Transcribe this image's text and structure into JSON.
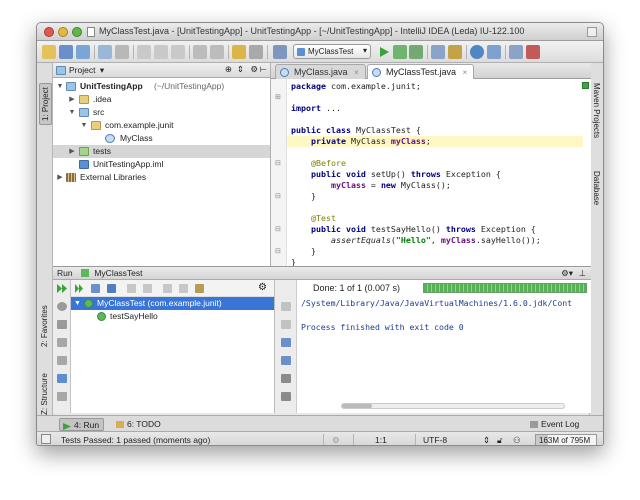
{
  "window": {
    "title": "MyClassTest.java - [UnitTestingApp] - UnitTestingApp - [~/UnitTestingApp] - IntelliJ IDEA (Leda) IU-122.100"
  },
  "toolbar": {
    "run_config": "MyClassTest"
  },
  "left_tool_tabs": {
    "project": "1: Project",
    "favorites": "2: Favorites",
    "structure": "Z: Structure"
  },
  "right_tool_tabs": {
    "maven": "Maven Projects",
    "database": "Database"
  },
  "project_panel": {
    "header_label": "Project",
    "tree": [
      {
        "label": "UnitTestingApp",
        "detail": "(~/UnitTestingApp)"
      },
      {
        "label": ".idea"
      },
      {
        "label": "src"
      },
      {
        "label": "com.example.junit"
      },
      {
        "label": "MyClass"
      },
      {
        "label": "tests"
      },
      {
        "label": "UnitTestingApp.iml"
      },
      {
        "label": "External Libraries"
      }
    ]
  },
  "editor": {
    "tabs": [
      {
        "label": "MyClass.java"
      },
      {
        "label": "MyClassTest.java"
      }
    ],
    "code": {
      "l1_kw": "package",
      "l1_rest": " com.example.junit;",
      "l2_kw": "import",
      "l2_rest": " ...",
      "l3_kw": "public class",
      "l3_rest": " MyClassTest {",
      "l4_kw": "private",
      "l4_type": " MyClass ",
      "l4_field": "myClass",
      "l4_end": ";",
      "l5_ann": "@Before",
      "l6_kw": "public void",
      "l6_mid": " setUp() ",
      "l6_kw2": "throws",
      "l6_end": " Exception {",
      "l7_field": "myClass",
      "l7_mid": " = ",
      "l7_kw": "new",
      "l7_end": " MyClass();",
      "l8": "}",
      "l9_ann": "@Test",
      "l10_kw": "public void",
      "l10_mid": " testSayHello() ",
      "l10_kw2": "throws",
      "l10_end": " Exception {",
      "l11_method": "assertEquals",
      "l11_open": "(",
      "l11_str": "\"Hello\"",
      "l11_comma": ", ",
      "l11_field": "myClass",
      "l11_end": ".sayHello());",
      "l12": "}",
      "l13": "}"
    }
  },
  "run_panel": {
    "header_label": "Run",
    "config_name": "MyClassTest",
    "status": "Done: 1 of 1 (0.007 s)",
    "progress": 1.0,
    "tree": [
      {
        "label": "MyClassTest (com.example.junit)"
      },
      {
        "label": "testSayHello"
      }
    ],
    "console_lines": [
      "/System/Library/Java/JavaVirtualMachines/1.6.0.jdk/Cont",
      "",
      "Process finished with exit code 0"
    ]
  },
  "bottom_tabs": {
    "run": "4: Run",
    "todo": "6: TODO",
    "event_log": "Event Log"
  },
  "statusbar": {
    "message": "Tests Passed: 1 passed (moments ago)",
    "position": "1:1",
    "encoding": "UTF-8",
    "memory": "163M of 795M",
    "memory_used_fraction": 0.2
  },
  "colors": {
    "pass_green": "#5cb85c",
    "selection_blue": "#3875d7",
    "keyword_navy": "#000080",
    "field_purple": "#660e7a",
    "string_green": "#008000",
    "annotation_olive": "#808000"
  }
}
